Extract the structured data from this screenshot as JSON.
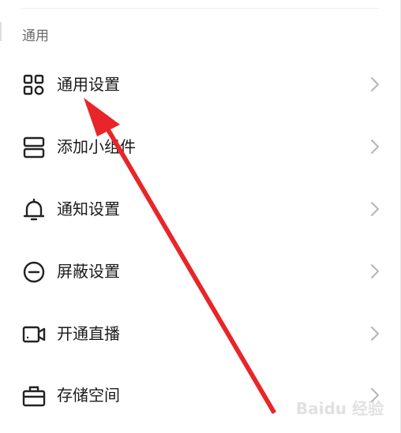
{
  "section": {
    "title": "通用"
  },
  "menu": {
    "items": [
      {
        "label": "通用设置",
        "icon": "grid-apps-icon"
      },
      {
        "label": "添加小组件",
        "icon": "widget-stack-icon"
      },
      {
        "label": "通知设置",
        "icon": "bell-icon"
      },
      {
        "label": "屏蔽设置",
        "icon": "block-circle-icon"
      },
      {
        "label": "开通直播",
        "icon": "video-camera-icon"
      },
      {
        "label": "存储空间",
        "icon": "briefcase-storage-icon"
      }
    ]
  },
  "annotation": {
    "arrow_color": "#e8262a",
    "watermark": "Baidu 经验"
  }
}
